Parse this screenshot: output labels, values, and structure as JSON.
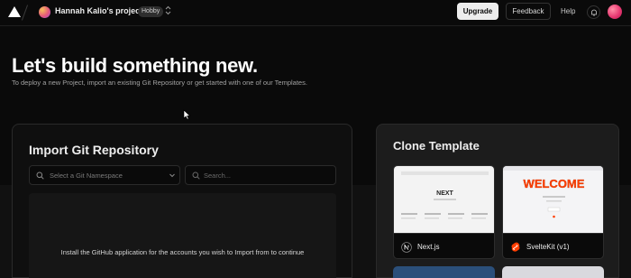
{
  "topbar": {
    "team_name": "Hannah Kalio's projects",
    "plan_badge": "Hobby",
    "upgrade_label": "Upgrade",
    "feedback_label": "Feedback",
    "help_label": "Help"
  },
  "hero": {
    "title": "Let's build something new.",
    "subtitle": "To deploy a new Project, import an existing Git Repository or get started with one of our Templates."
  },
  "import": {
    "title": "Import Git Repository",
    "namespace_placeholder": "Select a Git Namespace",
    "search_placeholder": "Search...",
    "install_text": "Install the GitHub application for the accounts you wish to Import from to continue"
  },
  "clone": {
    "title": "Clone Template",
    "templates": [
      {
        "name": "Next.js",
        "icon": "nextjs-icon",
        "thumb_text": "NEXT"
      },
      {
        "name": "SvelteKit (v1)",
        "icon": "svelte-icon",
        "thumb_text": "WELCOME"
      }
    ]
  },
  "colors": {
    "background": "#0a0a0a",
    "panel": "#0f0f0f",
    "clone_panel": "#1c1c1c",
    "svelte_orange": "#ff3e00"
  },
  "icons": [
    "vercel-logo-icon",
    "team-avatar",
    "switch-chevrons-icon",
    "bell-icon",
    "user-avatar",
    "search-icon",
    "chevron-down-icon",
    "nextjs-icon",
    "svelte-icon"
  ]
}
